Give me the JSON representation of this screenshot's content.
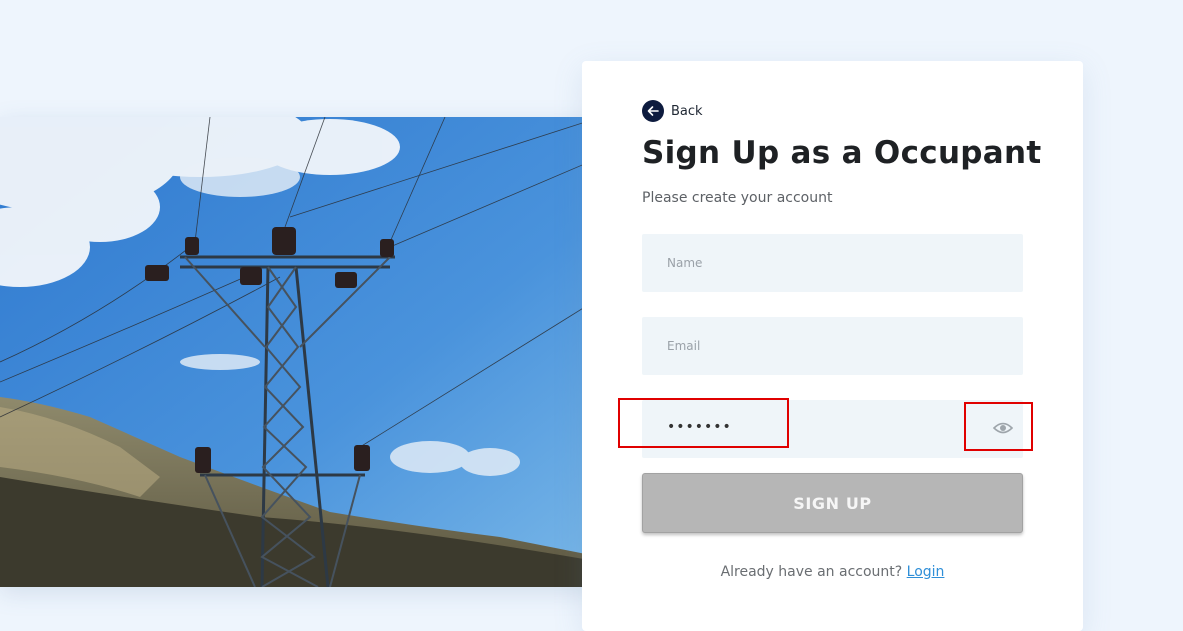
{
  "back": {
    "label": "Back",
    "icon": "arrow-left-icon"
  },
  "title": "Sign Up as a Occupant",
  "subtitle": "Please create your account",
  "form": {
    "name_placeholder": "Name",
    "email_placeholder": "Email",
    "password_value": "•••••••",
    "password_toggle_icon": "eye-icon",
    "submit_label": "SIGN UP"
  },
  "footer": {
    "prompt": "Already have an account?",
    "login_label": "Login"
  },
  "colors": {
    "page_bg": "#eef5fd",
    "accent_dark": "#0d1b3e",
    "link": "#2f8fd8",
    "button_disabled": "#b6b6b6",
    "highlight": "#e00000"
  }
}
